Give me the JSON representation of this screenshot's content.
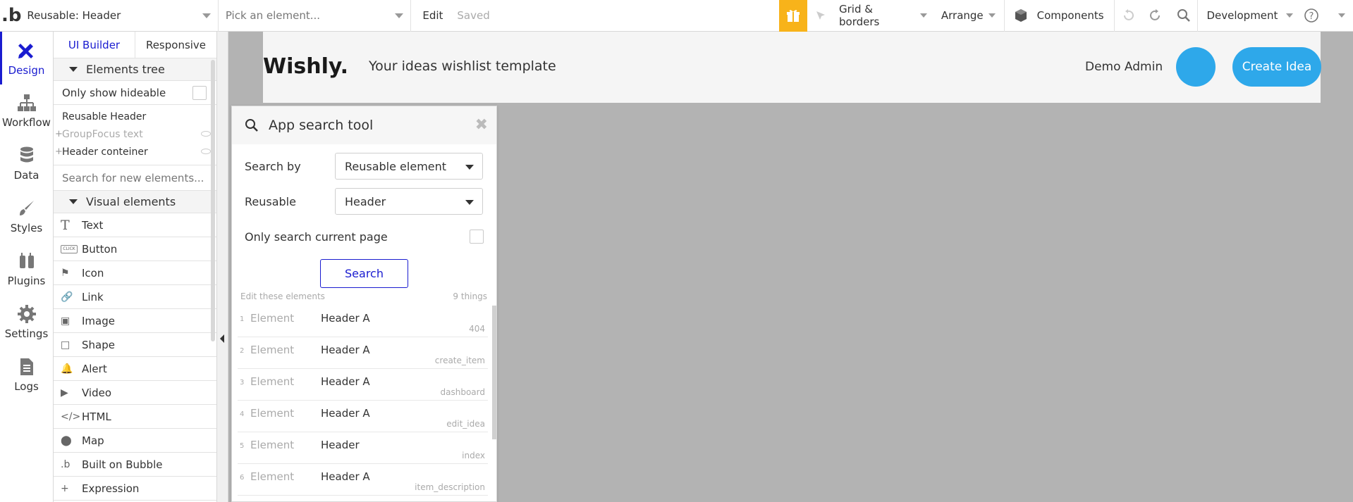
{
  "topbar": {
    "logo": ".b",
    "page_select": "Reusable: Header",
    "element_picker_placeholder": "Pick an element...",
    "edit_label": "Edit",
    "saved_label": "Saved",
    "grid_borders_label": "Grid & borders",
    "arrange_label": "Arrange",
    "components_label": "Components",
    "environment_label": "Development"
  },
  "rail": {
    "items": [
      {
        "label": "Design",
        "icon": "design-icon"
      },
      {
        "label": "Workflow",
        "icon": "workflow-icon"
      },
      {
        "label": "Data",
        "icon": "data-icon"
      },
      {
        "label": "Styles",
        "icon": "styles-icon"
      },
      {
        "label": "Plugins",
        "icon": "plugins-icon"
      },
      {
        "label": "Settings",
        "icon": "settings-icon"
      },
      {
        "label": "Logs",
        "icon": "logs-icon"
      }
    ]
  },
  "panel": {
    "tabs": [
      "UI Builder",
      "Responsive"
    ],
    "elements_tree_label": "Elements tree",
    "only_hideable_label": "Only show hideable",
    "tree": [
      {
        "label": "Reusable Header"
      },
      {
        "label": "GroupFocus text"
      },
      {
        "label": "Header conteiner"
      }
    ],
    "search_new_placeholder": "Search for new elements...",
    "visual_elements_label": "Visual elements",
    "visual_elements": [
      {
        "label": "Text",
        "icon": "T"
      },
      {
        "label": "Button",
        "icon": "CLICK"
      },
      {
        "label": "Icon",
        "icon": "⚑"
      },
      {
        "label": "Link",
        "icon": "🔗"
      },
      {
        "label": "Image",
        "icon": "▣"
      },
      {
        "label": "Shape",
        "icon": "□"
      },
      {
        "label": "Alert",
        "icon": "🔔"
      },
      {
        "label": "Video",
        "icon": "▶"
      },
      {
        "label": "HTML",
        "icon": "</>"
      },
      {
        "label": "Map",
        "icon": "⬤"
      },
      {
        "label": "Built on Bubble",
        "icon": ".b"
      },
      {
        "label": "Expression",
        "icon": "+"
      }
    ]
  },
  "canvas": {
    "brand": "Wishly.",
    "tagline": "Your ideas wishlist template",
    "admin_name": "Demo Admin",
    "create_button": "Create Idea",
    "accent_color": "#2ea8ea"
  },
  "search_tool": {
    "title": "App search tool",
    "search_by_label": "Search by",
    "search_by_value": "Reusable element",
    "reusable_label": "Reusable",
    "reusable_value": "Header",
    "only_current_page_label": "Only search current page",
    "search_button": "Search",
    "edit_label": "Edit these elements",
    "count_label": "9 things",
    "results": [
      {
        "num": "1",
        "type": "Element",
        "name": "Header A",
        "page": "404"
      },
      {
        "num": "2",
        "type": "Element",
        "name": "Header A",
        "page": "create_item"
      },
      {
        "num": "3",
        "type": "Element",
        "name": "Header A",
        "page": "dashboard"
      },
      {
        "num": "4",
        "type": "Element",
        "name": "Header A",
        "page": "edit_idea"
      },
      {
        "num": "5",
        "type": "Element",
        "name": "Header",
        "page": "index"
      },
      {
        "num": "6",
        "type": "Element",
        "name": "Header A",
        "page": "item_description"
      }
    ]
  }
}
